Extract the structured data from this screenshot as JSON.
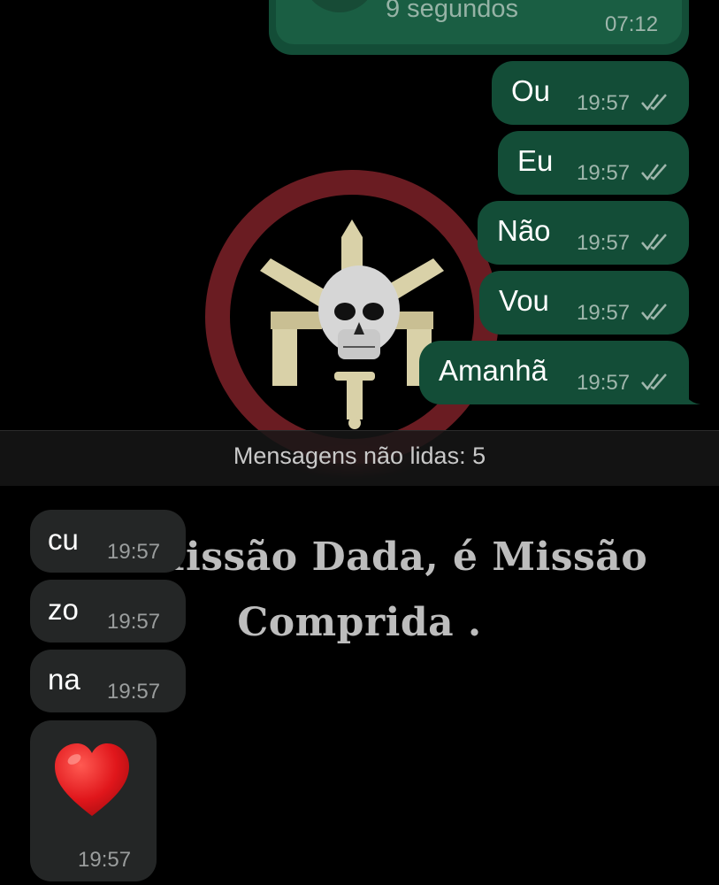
{
  "call": {
    "subtitle": "9 segundos",
    "time": "07:12"
  },
  "outgoing": [
    {
      "text": "Ou",
      "time": "19:57"
    },
    {
      "text": "Eu",
      "time": "19:57"
    },
    {
      "text": "Não",
      "time": "19:57"
    },
    {
      "text": "Vou",
      "time": "19:57"
    },
    {
      "text": "Amanhã",
      "time": "19:57"
    }
  ],
  "unread": {
    "label": "Mensagens não lidas: 5"
  },
  "incoming": [
    {
      "text": "cu",
      "time": "19:57"
    },
    {
      "text": "zo",
      "time": "19:57"
    },
    {
      "text": "na",
      "time": "19:57"
    },
    {
      "emoji": "heart",
      "time": "19:57"
    }
  ],
  "wallpaper": {
    "line1": "Missão Dada, é Missão",
    "line2": "Comprida .",
    "ring_color": "#6a1c22",
    "emblem_color": "#d9d1a8"
  },
  "colors": {
    "outgoing_bubble": "#134d37",
    "incoming_bubble": "#242626",
    "background": "#000000"
  }
}
